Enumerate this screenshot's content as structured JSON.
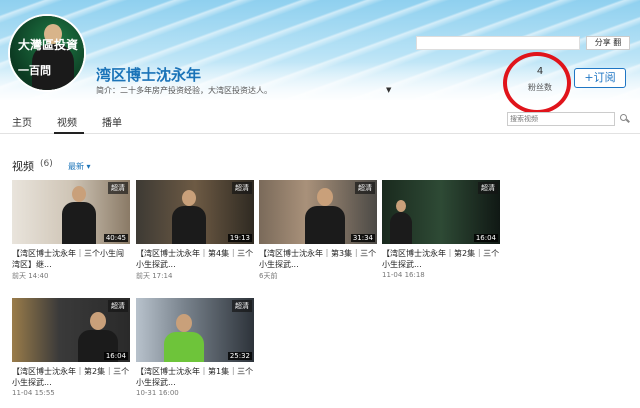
{
  "channel": {
    "name": "湾区博士沈永年",
    "description": "简介：二十多年房产投资经验，大湾区投资达人。",
    "avatar_text_1": "大灣區投資",
    "avatar_text_2": "一百問",
    "subscriber_count": "4",
    "subscriber_label": "粉丝数",
    "subscribe_label": "+订阅",
    "share_label": "分享 翻"
  },
  "tabs": [
    {
      "label": "主页"
    },
    {
      "label": "视频",
      "active": true
    },
    {
      "label": "播单"
    }
  ],
  "search": {
    "placeholder": "搜索视频"
  },
  "section": {
    "title": "视频",
    "count": "(6)",
    "sort": "最新 ▾"
  },
  "videos": [
    {
      "badge": "超清",
      "duration": "40:45",
      "title": "【湾区博士沈永年｜三个小生闯湾区】继...",
      "meta": "前天 14:40"
    },
    {
      "badge": "超清",
      "duration": "19:13",
      "title": "【湾区博士沈永年｜第4集｜三个小生探武...",
      "meta": "前天 17:14"
    },
    {
      "badge": "超清",
      "duration": "31:34",
      "title": "【湾区博士沈永年｜第3集｜三个小生探武...",
      "meta": "6天前"
    },
    {
      "badge": "超清",
      "duration": "16:04",
      "title": "【湾区博士沈永年｜第2集｜三个小生探武...",
      "meta": "11-04 16:18"
    },
    {
      "badge": "超清",
      "duration": "16:04",
      "title": "【湾区博士沈永年｜第2集｜三个小生探武...",
      "meta": "11-04 15:55"
    },
    {
      "badge": "超清",
      "duration": "25:32",
      "title": "【湾区博士沈永年｜第1集｜三个小生探武...",
      "meta": "10-31 16:00"
    }
  ],
  "colors": {
    "accent": "#1a73b8",
    "highlight": "#e0141b"
  }
}
